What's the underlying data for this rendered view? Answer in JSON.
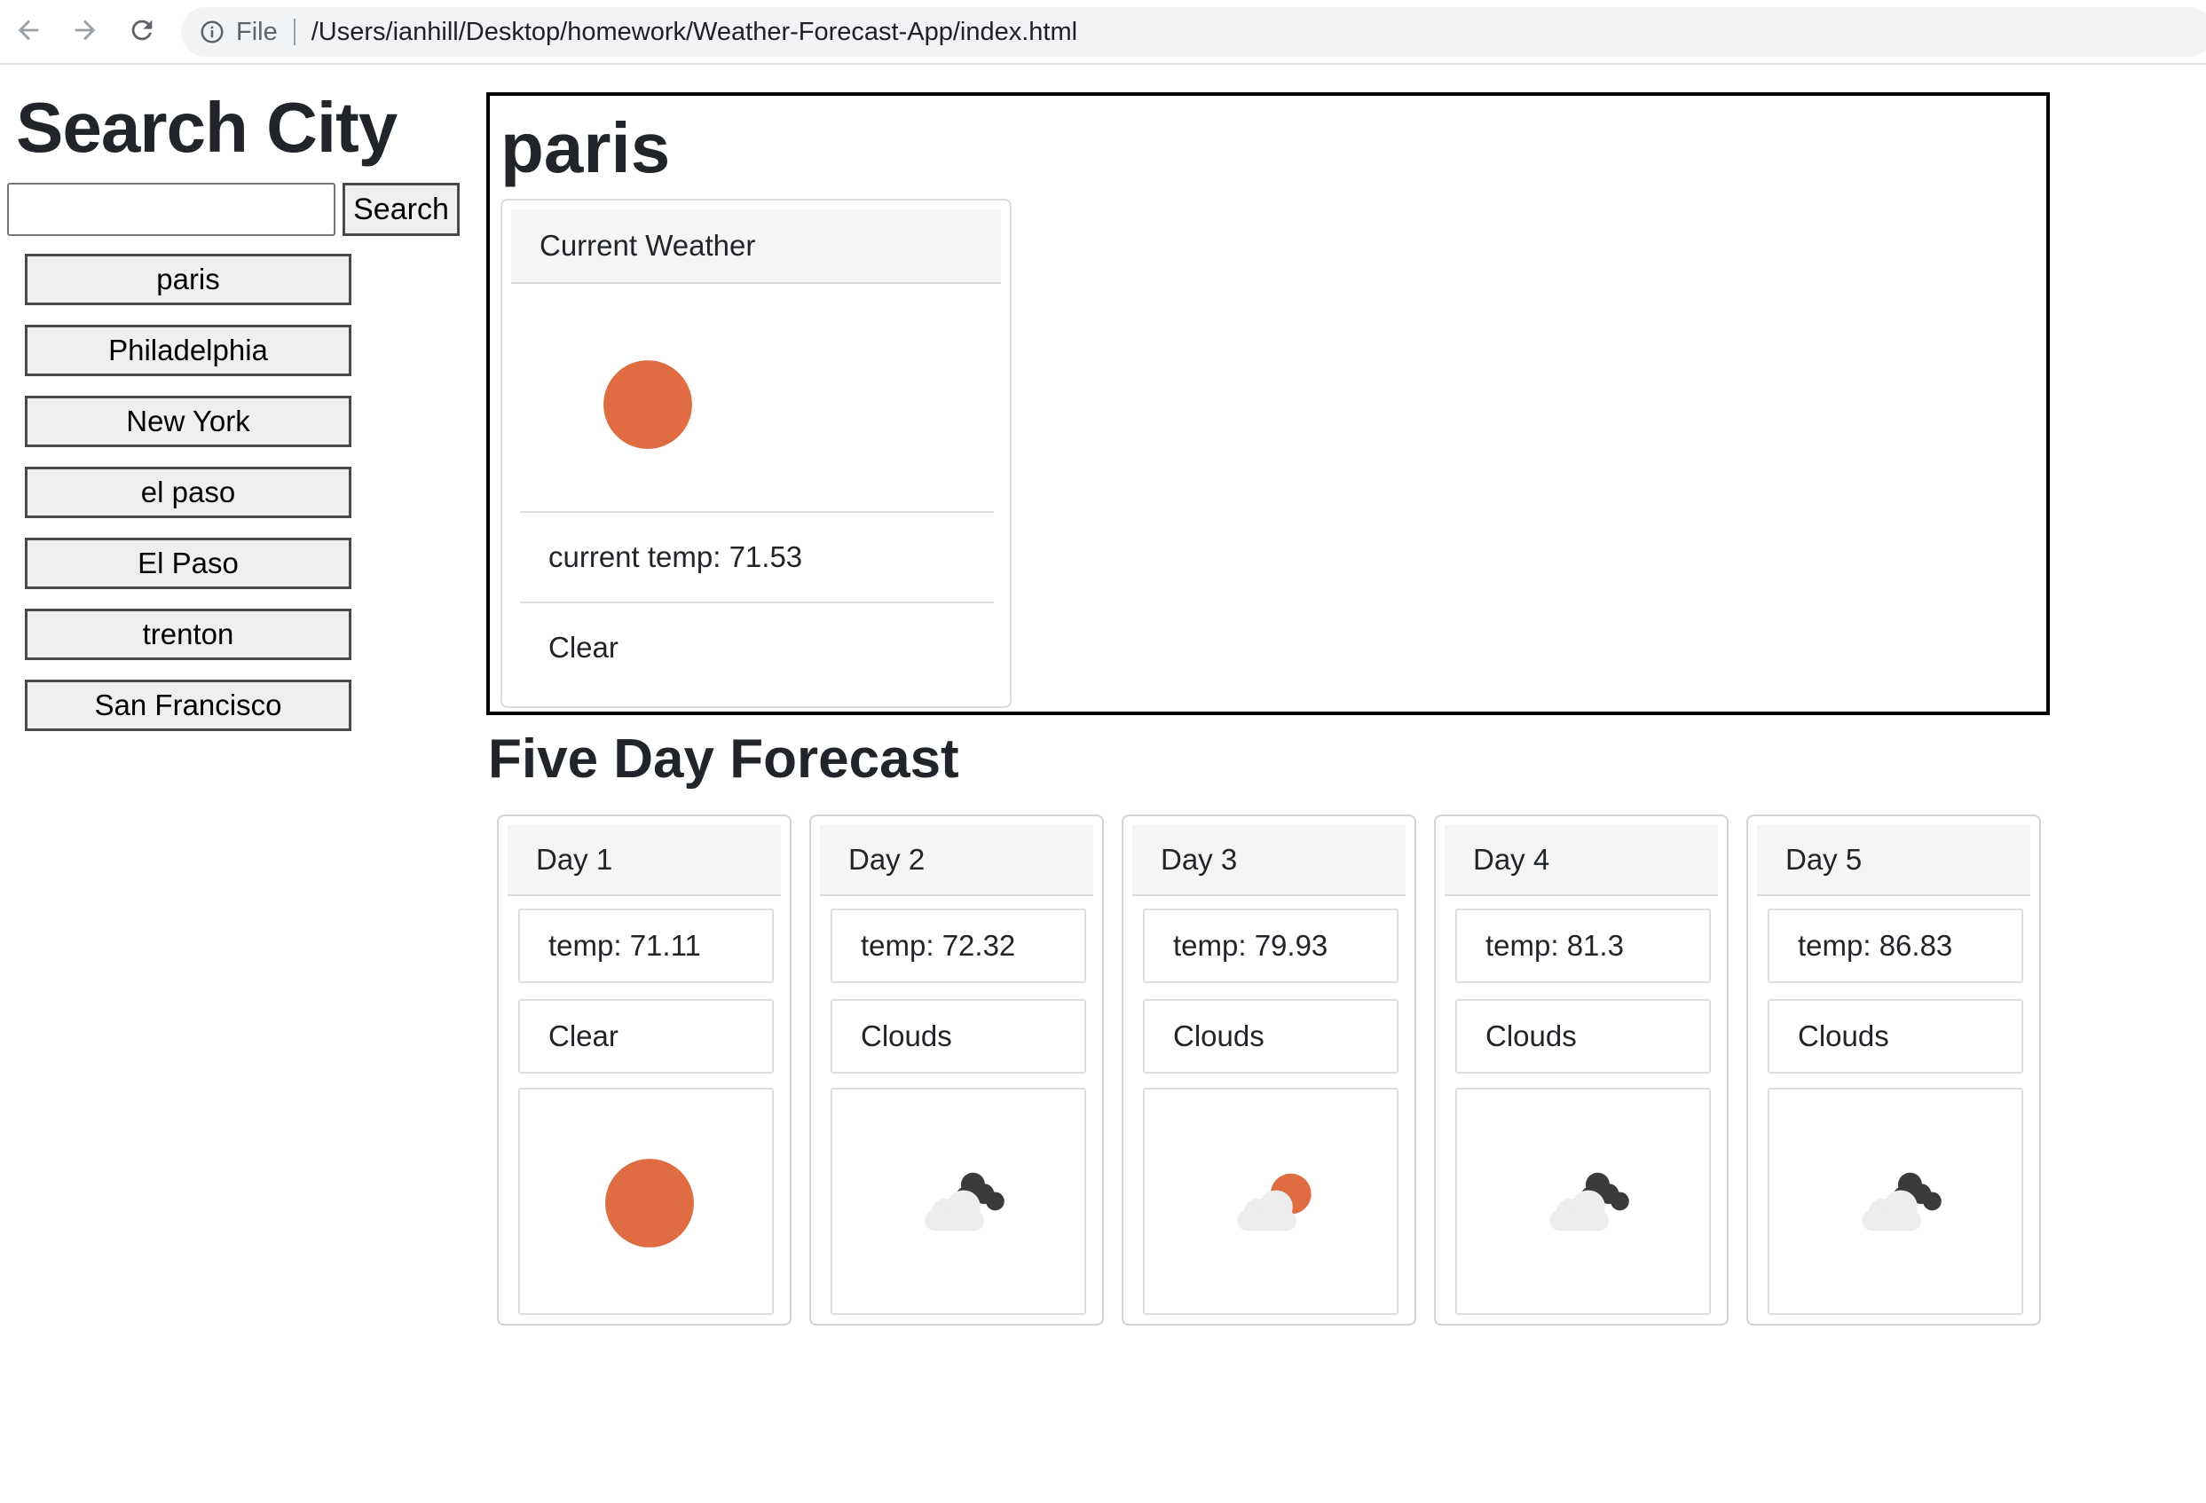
{
  "browser": {
    "file_label": "File",
    "url": "/Users/ianhill/Desktop/homework/Weather-Forecast-App/index.html"
  },
  "sidebar": {
    "title": "Search City",
    "search_value": "",
    "search_button": "Search",
    "cities": [
      "paris",
      "Philadelphia",
      "New York",
      "el paso",
      "El Paso",
      "trenton",
      "San Francisco"
    ]
  },
  "current": {
    "city": "paris",
    "header": "Current Weather",
    "icon": "clear-sun-icon",
    "temp": "current temp: 71.53",
    "condition": "Clear"
  },
  "forecast": {
    "title": "Five Day Forecast",
    "days": [
      {
        "label": "Day 1",
        "temp": "temp: 71.11",
        "condition": "Clear",
        "icon": "clear-sun-icon"
      },
      {
        "label": "Day 2",
        "temp": "temp: 72.32",
        "condition": "Clouds",
        "icon": "broken-clouds-icon"
      },
      {
        "label": "Day 3",
        "temp": "temp: 79.93",
        "condition": "Clouds",
        "icon": "few-clouds-icon"
      },
      {
        "label": "Day 4",
        "temp": "temp: 81.3",
        "condition": "Clouds",
        "icon": "broken-clouds-icon"
      },
      {
        "label": "Day 5",
        "temp": "temp: 86.83",
        "condition": "Clouds",
        "icon": "broken-clouds-icon"
      }
    ]
  },
  "colors": {
    "sun": "#E06C42",
    "cloud_light": "#EDEDED",
    "cloud_dark": "#3A3A3A"
  }
}
